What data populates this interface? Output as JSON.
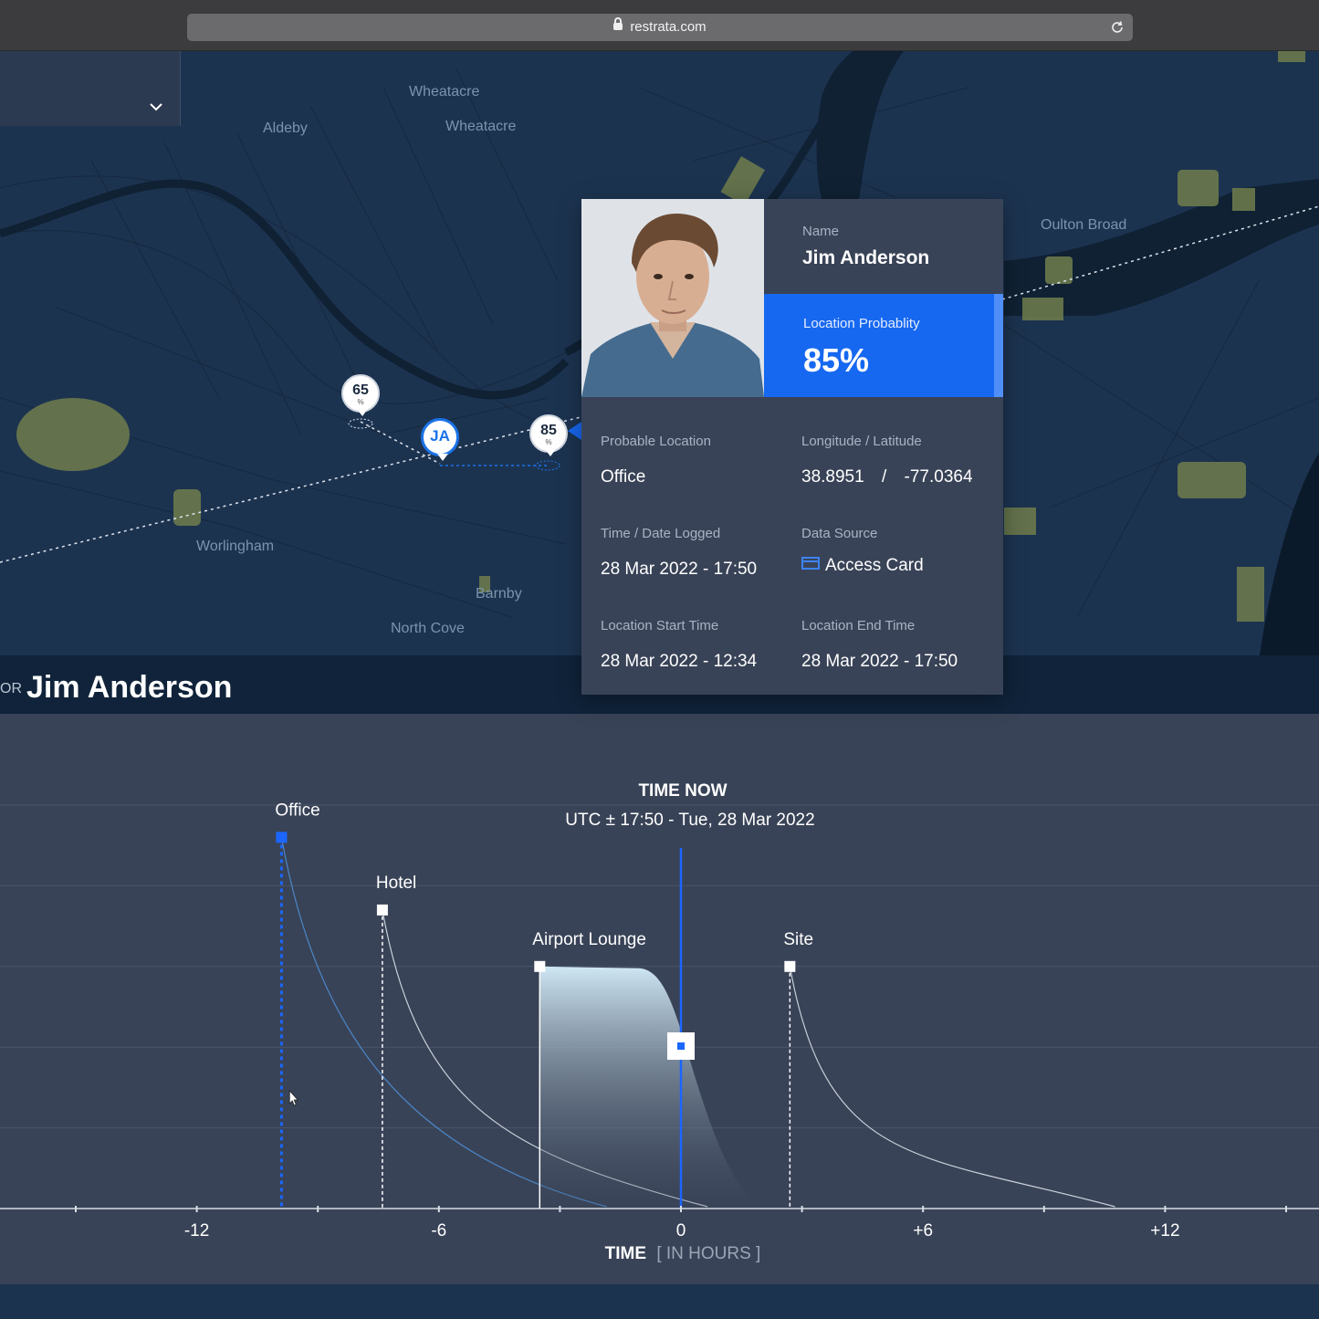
{
  "browser": {
    "url": "restrata.com"
  },
  "map": {
    "places": [
      "Wheatacre",
      "Wheatacre",
      "Aldeby",
      "Oulton Broad",
      "Worlingham",
      "Barnby",
      "North Cove"
    ],
    "pins": [
      {
        "value": "65",
        "unit": "%"
      },
      {
        "value": "JA"
      },
      {
        "value": "85",
        "unit": "%"
      }
    ]
  },
  "card": {
    "name_label": "Name",
    "name": "Jim Anderson",
    "probability_label": "Location Probablity",
    "probability": "85%",
    "probable_location_label": "Probable Location",
    "probable_location": "Office",
    "lonlat_label": "Longitude / Latitude",
    "longitude": "38.8951",
    "lonlat_sep": "/",
    "latitude": "-77.0364",
    "time_logged_label": "Time / Date Logged",
    "time_logged": "28 Mar 2022 - 17:50",
    "data_source_label": "Data Source",
    "data_source": "Access Card",
    "start_label": "Location Start Time",
    "start": "28 Mar 2022 - 12:34",
    "end_label": "Location End Time",
    "end": "28 Mar 2022 - 17:50"
  },
  "title": {
    "prefix": "OR",
    "name": "Jim Anderson"
  },
  "chart_data": {
    "type": "area",
    "title": "TIME NOW",
    "subtitle": "UTC ± 17:50 - Tue, 28 Mar 2022",
    "xlabel": "TIME",
    "xlabel_unit": "[ IN HOURS ]",
    "xlim": [
      -17,
      16
    ],
    "ticks": [
      -12,
      -6,
      0,
      6,
      12
    ],
    "tick_labels": [
      "-12",
      "-6",
      "0",
      "+6",
      "+12"
    ],
    "now": 0,
    "selected_color": "#1a66ff",
    "series": [
      {
        "name": "Office",
        "x": -9.9,
        "level": 0.92,
        "selected": true
      },
      {
        "name": "Hotel",
        "x": -7.4,
        "level": 0.74
      },
      {
        "name": "Airport Lounge",
        "x": -3.5,
        "level": 0.6,
        "filled": true
      },
      {
        "name": "Site",
        "x": 2.7,
        "level": 0.6
      }
    ]
  }
}
